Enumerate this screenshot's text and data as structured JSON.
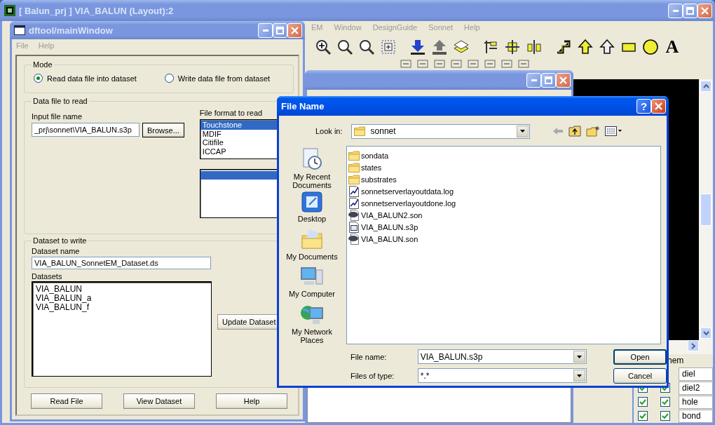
{
  "main_window": {
    "title": "[ Balun_prj ] VIA_BALUN (Layout):2",
    "menu": [
      "EM",
      "Window",
      "DesignGuide",
      "Sonnet",
      "Help"
    ],
    "text_tool": "A",
    "layers_header": "hem",
    "layers": [
      {
        "name": "diel"
      },
      {
        "name": "diel2",
        "visible": true,
        "selectable": true
      },
      {
        "name": "hole",
        "visible": true,
        "selectable": true
      },
      {
        "name": "bond",
        "visible": true,
        "selectable": true
      }
    ]
  },
  "dftool": {
    "title": "dftool/mainWindow",
    "menu": [
      {
        "label": "File",
        "disabled": true
      },
      {
        "label": "Help",
        "disabled": true
      }
    ],
    "mode": {
      "label": "Mode",
      "options": [
        {
          "label": "Read data file into dataset",
          "selected": true
        },
        {
          "label": "Write data file from dataset",
          "selected": false
        }
      ]
    },
    "data_file": {
      "label": "Data file to read",
      "input_label": "Input file name",
      "input_value": "_prj\\sonnet\\VIA_BALUN.s3p",
      "browse": "Browse...",
      "format_label": "File format to read",
      "formats": [
        {
          "label": "Touchstone",
          "selected": true
        },
        {
          "label": "MDIF",
          "selected": false
        },
        {
          "label": "Citifile",
          "selected": false
        },
        {
          "label": "ICCAP",
          "selected": false
        }
      ],
      "second_list": [
        {
          "selected": true
        }
      ]
    },
    "dataset": {
      "label": "Dataset to write",
      "name_label": "Dataset name",
      "name_value": "VIA_BALUN_SonnetEM_Dataset.ds",
      "datasets_label": "Datasets",
      "datasets": [
        "VIA_BALUN",
        "VIA_BALUN_a",
        "VIA_BALUN_f"
      ],
      "update": "Update Dataset"
    },
    "buttons": [
      "Read File",
      "View Dataset",
      "Help"
    ]
  },
  "file_dialog": {
    "title": "File Name",
    "help_glyph": "?",
    "look_in_label": "Look in:",
    "look_in": "sonnet",
    "places": [
      {
        "label": "My Recent Documents",
        "kind": "recent"
      },
      {
        "label": "Desktop",
        "kind": "desktop"
      },
      {
        "label": "My Documents",
        "kind": "documents"
      },
      {
        "label": "My Computer",
        "kind": "computer"
      },
      {
        "label": "My Network Places",
        "kind": "network"
      }
    ],
    "files": [
      {
        "name": "sondata",
        "kind": "folder"
      },
      {
        "name": "states",
        "kind": "folder"
      },
      {
        "name": "substrates",
        "kind": "folder"
      },
      {
        "name": "sonnetserverlayoutdata.log",
        "kind": "log"
      },
      {
        "name": "sonnetserverlayoutdone.log",
        "kind": "log"
      },
      {
        "name": "VIA_BALUN2.son",
        "kind": "son"
      },
      {
        "name": "VIA_BALUN.s3p",
        "kind": "s3p"
      },
      {
        "name": "VIA_BALUN.son",
        "kind": "son"
      }
    ],
    "file_name_label": "File name:",
    "file_name": "VIA_BALUN.s3p",
    "file_type_label": "Files of type:",
    "file_type": "*.*",
    "buttons": [
      "Open",
      "Cancel"
    ]
  }
}
